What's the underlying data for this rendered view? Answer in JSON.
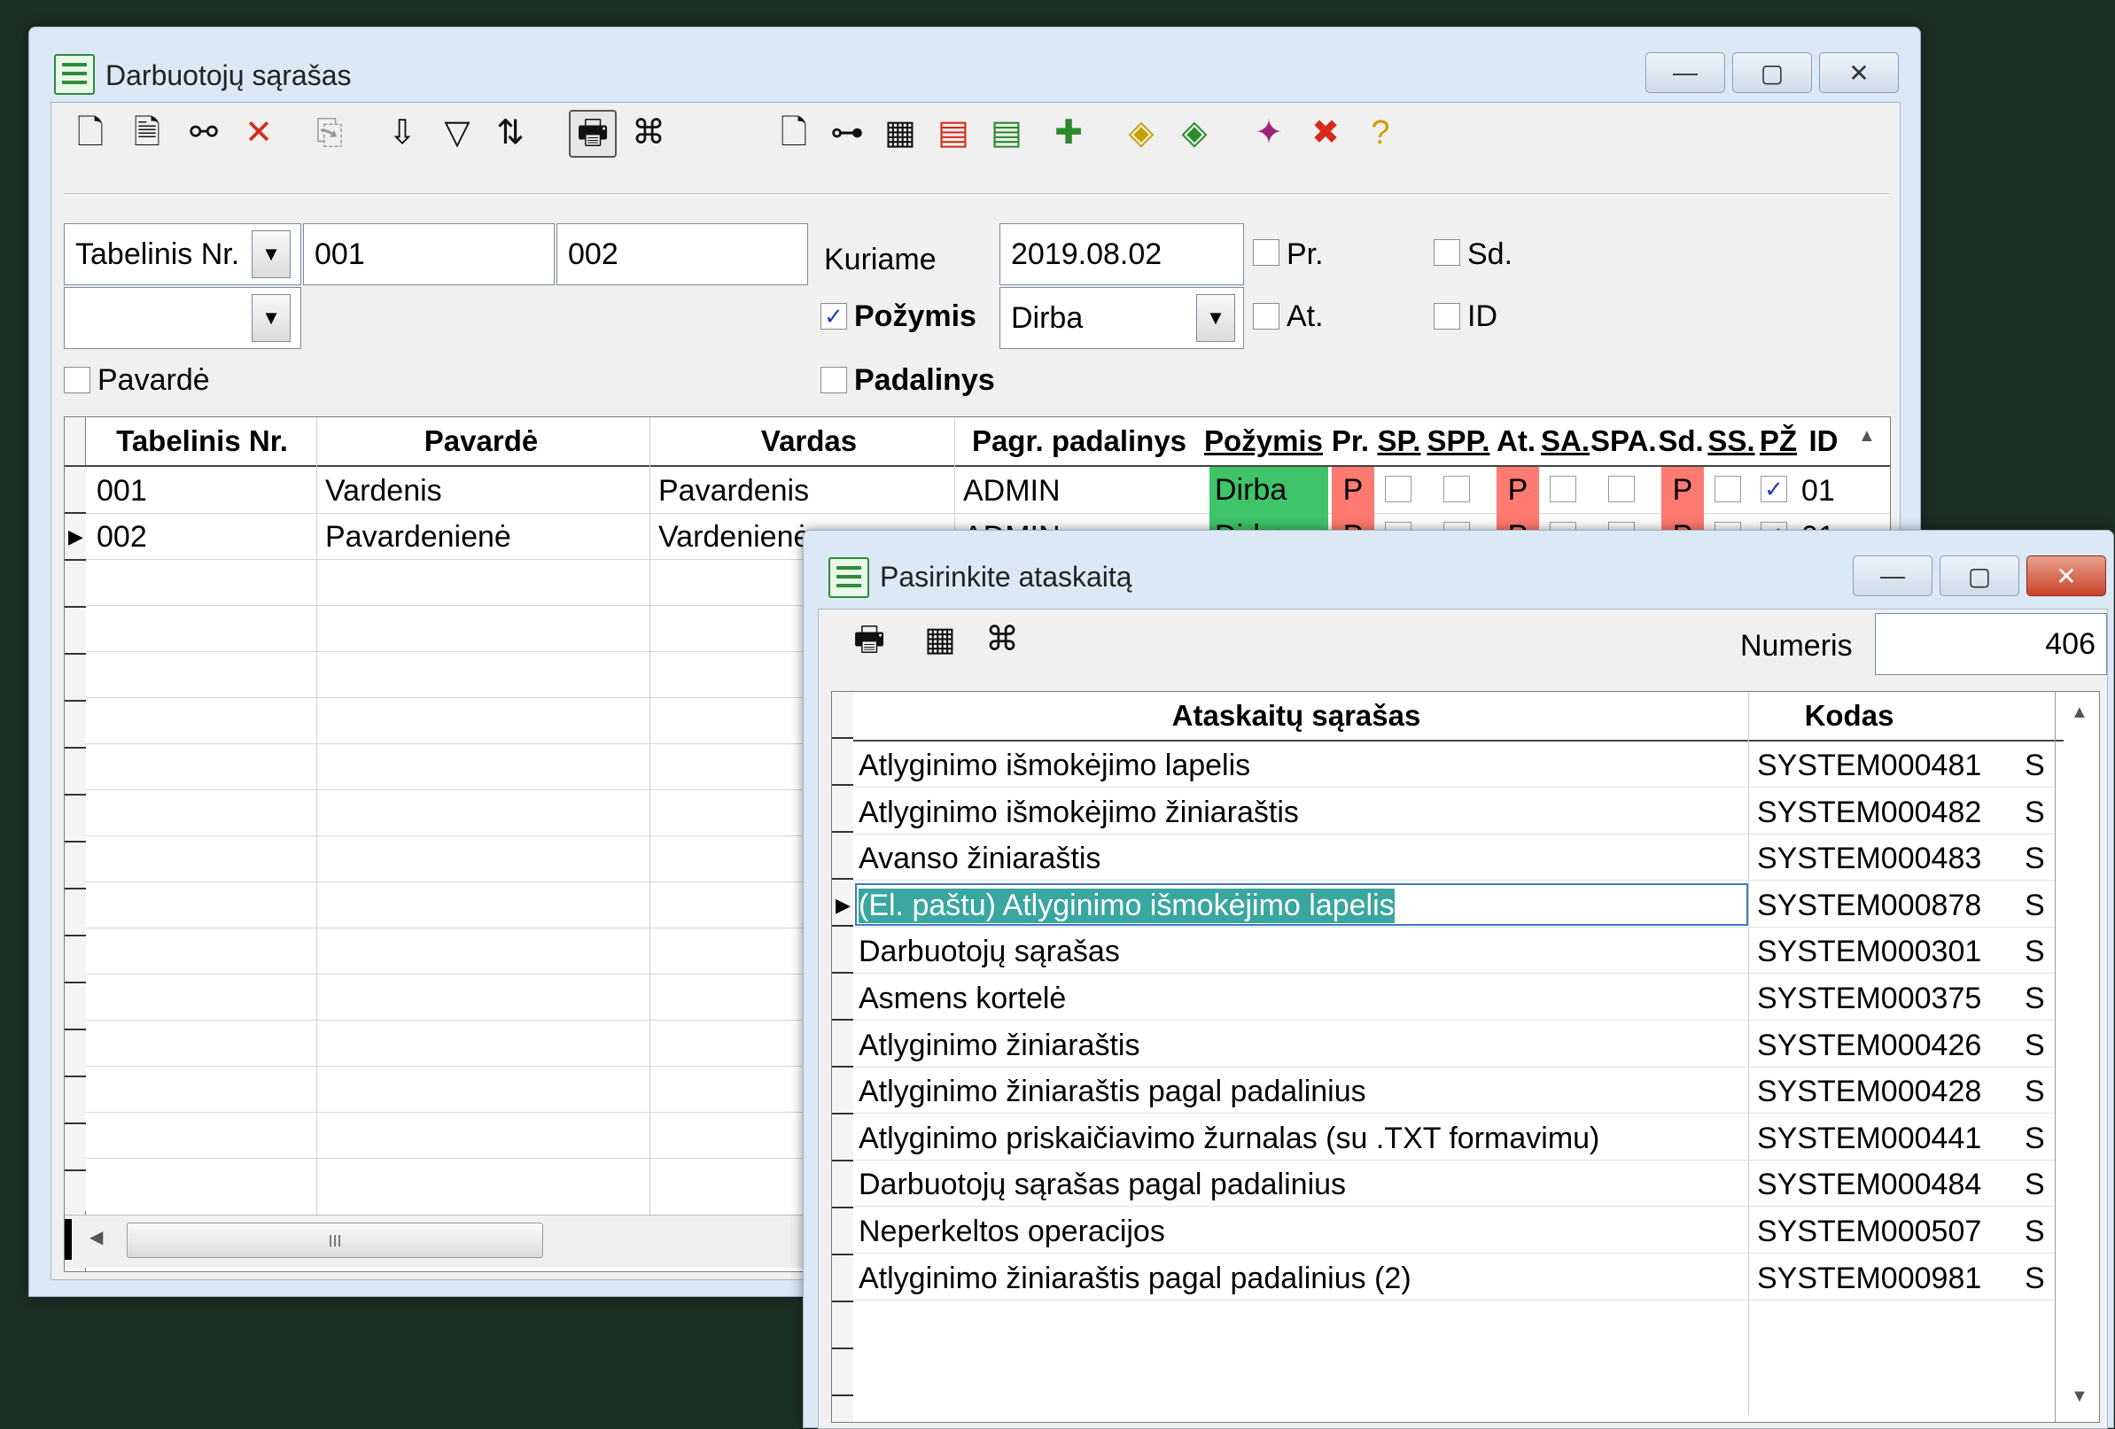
{
  "main_window": {
    "title": "Darbuotojų sąrašas",
    "controls": {
      "minimize": "—",
      "maximize": "▢",
      "close": "✕"
    },
    "filter": {
      "field_select": "Tabelinis Nr.",
      "from": "001",
      "to": "002",
      "kuriame_label": "Kuriame",
      "date": "2019.08.02",
      "pr_label": "Pr.",
      "sd_label": "Sd.",
      "pozymis_label": "Požymis",
      "pozymis_value": "Dirba",
      "at_label": "At.",
      "id_label": "ID",
      "pavarde_label": "Pavardė",
      "padalinys_label": "Padalinys"
    },
    "grid": {
      "headers": [
        "Tabelinis Nr.",
        "Pavardė",
        "Vardas",
        "Pagr. padalinys",
        "Požymis",
        "Pr.",
        "SP.",
        "SPP.",
        "At.",
        "SA.",
        "SPA.",
        "Sd.",
        "SS.",
        "PŽ",
        "ID"
      ],
      "rows": [
        {
          "tab": "001",
          "pavarde": "Vardenis",
          "vardas": "Pavardenis",
          "padalinys": "ADMIN",
          "pozymis": "Dirba",
          "pr": "P",
          "at": "P",
          "sd": "P",
          "id": "01"
        },
        {
          "tab": "002",
          "pavarde": "Pavardenienė",
          "vardas": "Vardenienė",
          "padalinys": "ADMIN",
          "pozymis": "Dirba",
          "pr": "P",
          "at": "P",
          "sd": "P",
          "id": "01"
        }
      ],
      "scroll_thumb": "III",
      "status_color": "#3fc46a",
      "flag_color": "#ff7a70"
    }
  },
  "report_window": {
    "title": "Pasirinkite ataskaitą",
    "numeris_label": "Numeris",
    "numeris_value": "406",
    "headers": {
      "name": "Ataskaitų sąrašas",
      "code": "Kodas"
    },
    "rows": [
      {
        "name": "Atlyginimo išmokėjimo lapelis",
        "code": "SYSTEM000481",
        "s": "S"
      },
      {
        "name": "Atlyginimo išmokėjimo žiniaraštis",
        "code": "SYSTEM000482",
        "s": "S"
      },
      {
        "name": "Avanso žiniaraštis",
        "code": "SYSTEM000483",
        "s": "S"
      },
      {
        "name": "(El. paštu) Atlyginimo išmokėjimo lapelis",
        "code": "SYSTEM000878",
        "s": "S"
      },
      {
        "name": "Darbuotojų sąrašas",
        "code": "SYSTEM000301",
        "s": "S"
      },
      {
        "name": "Asmens kortelė",
        "code": "SYSTEM000375",
        "s": "S"
      },
      {
        "name": "Atlyginimo žiniaraštis",
        "code": "SYSTEM000426",
        "s": "S"
      },
      {
        "name": "Atlyginimo žiniaraštis pagal padalinius",
        "code": "SYSTEM000428",
        "s": "S"
      },
      {
        "name": "Atlyginimo priskaičiavimo žurnalas (su .TXT formavimu)",
        "code": "SYSTEM000441",
        "s": "S"
      },
      {
        "name": "Darbuotojų sąrašas pagal padalinius",
        "code": "SYSTEM000484",
        "s": "S"
      },
      {
        "name": "Neperkeltos operacijos",
        "code": "SYSTEM000507",
        "s": "S"
      },
      {
        "name": "Atlyginimo žiniaraštis pagal padalinius (2)",
        "code": "SYSTEM000981",
        "s": "S"
      }
    ],
    "selected_index": 3,
    "selection_color": "#3aa6a0"
  }
}
